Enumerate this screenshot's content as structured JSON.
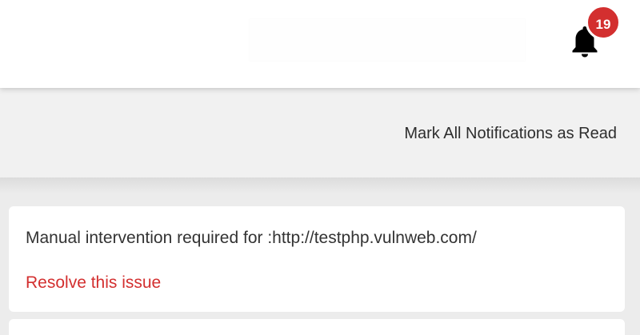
{
  "header": {
    "notification_count": "19",
    "bell_icon": "bell-icon",
    "badge_color": "#d32f2f"
  },
  "toolbar": {
    "mark_all_label": "Mark All Notifications as Read"
  },
  "notifications": [
    {
      "message": "Manual intervention required for :http://testphp.vulnweb.com/",
      "action_label": "Resolve this issue"
    }
  ],
  "colors": {
    "accent": "#d32f2f",
    "background": "#ececec",
    "card": "#ffffff"
  }
}
